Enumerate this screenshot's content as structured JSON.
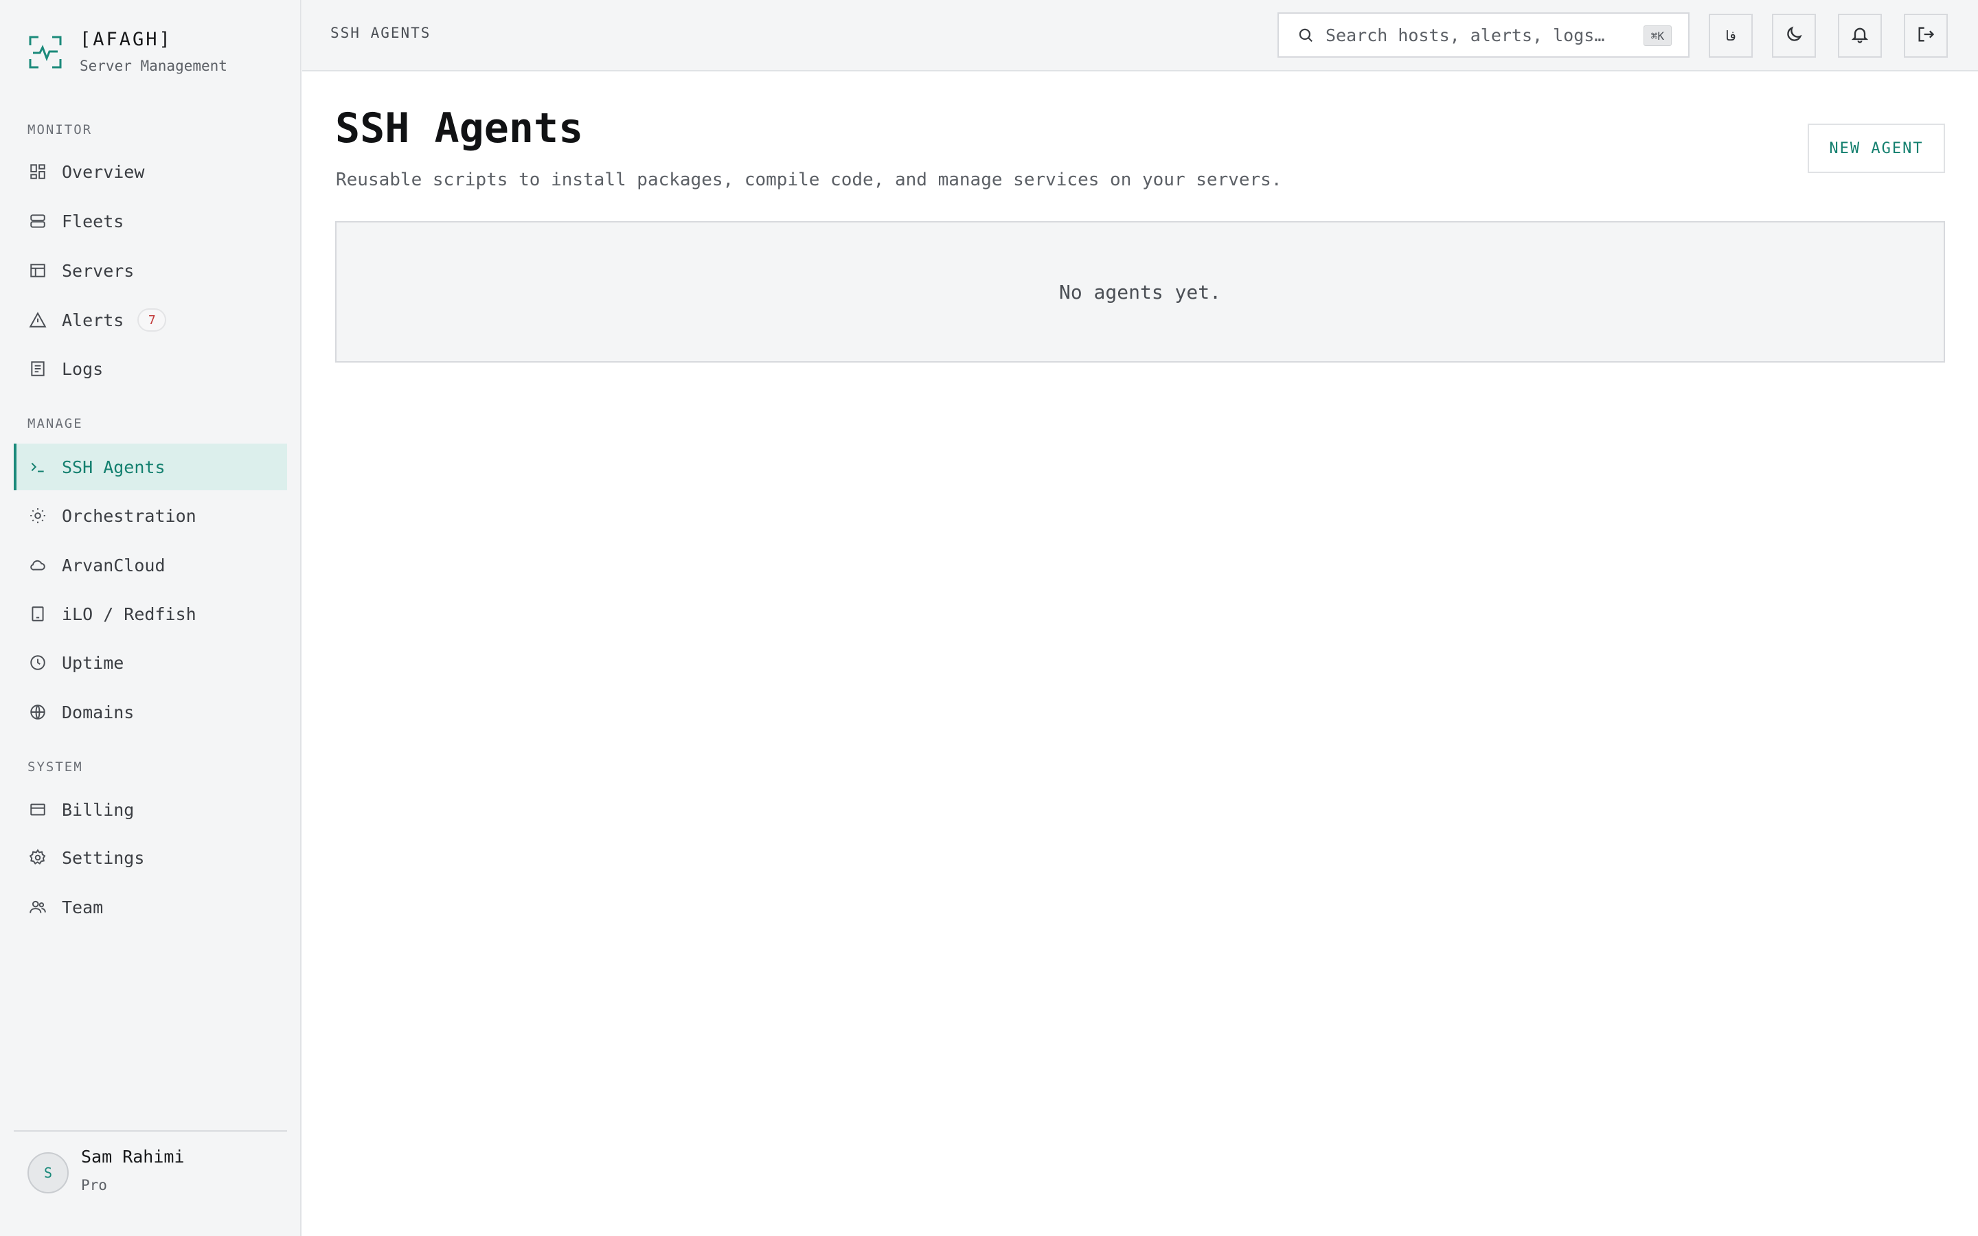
{
  "brand": {
    "name": "[AFAGH]",
    "subtitle": "Server Management",
    "logo_icon": "activity-scan-icon"
  },
  "sidebar": {
    "sections": [
      {
        "label": "MONITOR"
      },
      {
        "label": "MANAGE"
      },
      {
        "label": "SYSTEM"
      }
    ],
    "items": [
      {
        "label": "Overview",
        "icon": "grid-icon"
      },
      {
        "label": "Fleets",
        "icon": "server-stack-icon"
      },
      {
        "label": "Servers",
        "icon": "table-icon"
      },
      {
        "label": "Alerts",
        "icon": "warning-icon",
        "badge": "7"
      },
      {
        "label": "Logs",
        "icon": "document-icon"
      },
      {
        "label": "SSH Agents",
        "icon": "terminal-icon",
        "active": true
      },
      {
        "label": "Orchestration",
        "icon": "sun-cog-icon"
      },
      {
        "label": "ArvanCloud",
        "icon": "cloud-icon"
      },
      {
        "label": "iLO / Redfish",
        "icon": "tablet-icon"
      },
      {
        "label": "Uptime",
        "icon": "clock-icon"
      },
      {
        "label": "Domains",
        "icon": "globe-icon"
      },
      {
        "label": "Billing",
        "icon": "credit-card-icon"
      },
      {
        "label": "Settings",
        "icon": "gear-icon"
      },
      {
        "label": "Team",
        "icon": "users-icon"
      }
    ]
  },
  "user": {
    "initial": "S",
    "name": "Sam Rahimi",
    "plan": "Pro"
  },
  "topbar": {
    "breadcrumb": "SSH AGENTS",
    "search": {
      "placeholder": "Search hosts, alerts, logs…",
      "shortcut": "⌘K"
    },
    "language_label": "فا"
  },
  "main": {
    "title": "SSH Agents",
    "description": "Reusable scripts to install packages, compile code, and manage services on your servers.",
    "new_button": "NEW AGENT",
    "empty_message": "No agents yet."
  },
  "colors": {
    "accent": "#14806f",
    "active_bg": "#dcefec",
    "sidebar_bg": "#f4f5f6",
    "badge_text": "#c23b3b"
  }
}
